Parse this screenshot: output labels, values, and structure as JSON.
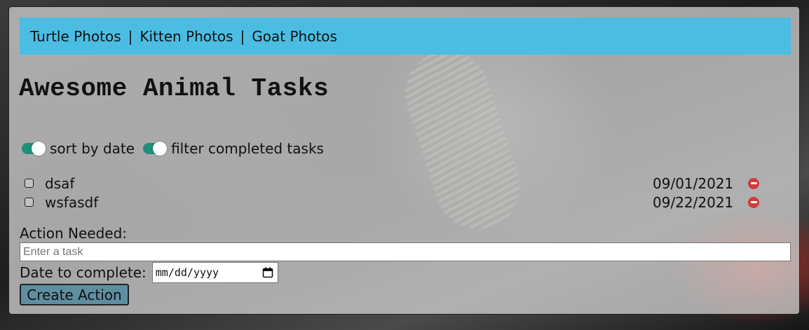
{
  "nav": {
    "links": [
      "Turtle Photos",
      "Kitten Photos",
      "Goat Photos"
    ],
    "separator": "|"
  },
  "page_title": "Awesome Animal Tasks",
  "toggles": {
    "sort_by_date": {
      "label": "sort by date",
      "on": true
    },
    "filter_completed": {
      "label": "filter completed tasks",
      "on": true
    }
  },
  "tasks": [
    {
      "name": "dsaf",
      "date": "09/01/2021",
      "completed": false
    },
    {
      "name": "wsfasdf",
      "date": "09/22/2021",
      "completed": false
    }
  ],
  "form": {
    "action_label": "Action Needed:",
    "action_placeholder": "Enter a task",
    "date_label": "Date to complete:",
    "date_placeholder": "mm/dd/yyyy",
    "submit_label": "Create Action"
  },
  "colors": {
    "navbar": "#4bbde3",
    "toggle_on": "#1f8f7a",
    "delete": "#d23a3a",
    "button": "#5f8ea0"
  },
  "icons": {
    "delete": "minus-circle-icon",
    "date": "calendar-icon"
  }
}
